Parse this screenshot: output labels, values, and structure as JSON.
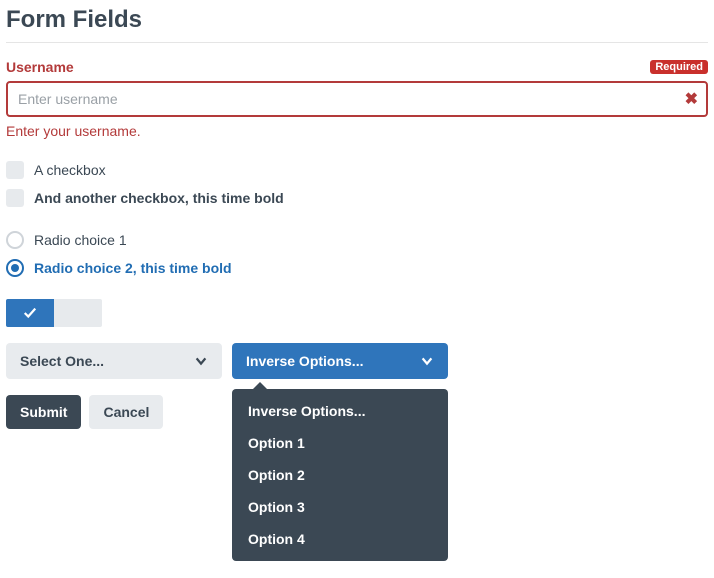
{
  "page": {
    "title": "Form Fields"
  },
  "username": {
    "label": "Username",
    "required_badge": "Required",
    "placeholder": "Enter username",
    "value": "",
    "help": "Enter your username."
  },
  "checkboxes": [
    {
      "label": "A checkbox",
      "checked": false,
      "bold": false
    },
    {
      "label": "And another checkbox, this time bold",
      "checked": false,
      "bold": true
    }
  ],
  "radios": [
    {
      "label": "Radio choice 1",
      "checked": false,
      "bold": false
    },
    {
      "label": "Radio choice 2, this time bold",
      "checked": true,
      "bold": true
    }
  ],
  "toggle": {
    "on": true
  },
  "selects": {
    "primary": {
      "label": "Select One..."
    },
    "inverse": {
      "label": "Inverse Options...",
      "open": true,
      "options": [
        "Inverse Options...",
        "Option 1",
        "Option 2",
        "Option 3",
        "Option 4"
      ]
    }
  },
  "buttons": {
    "submit": "Submit",
    "cancel": "Cancel"
  },
  "colors": {
    "error": "#b33a3a",
    "accent": "#2f75bb",
    "darkbg": "#3b4854",
    "lightbg": "#e8ebee"
  }
}
